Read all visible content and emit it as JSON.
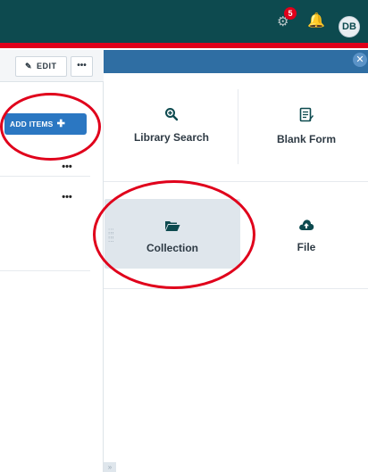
{
  "topbar": {
    "notifications_count": "5",
    "user_initials": "DB",
    "icons": [
      "gear-icon",
      "bell-icon"
    ]
  },
  "toolbar": {
    "edit_label": "EDIT",
    "more_label": "•••"
  },
  "sidebar": {
    "add_items_label": "ADD ITEMS",
    "row_more_label": "•••"
  },
  "tiles": {
    "library_search": "Library Search",
    "blank_form": "Blank Form",
    "collection": "Collection",
    "file": "File"
  },
  "colors": {
    "topbar": "#0d4a4f",
    "accent_red": "#e0001b",
    "modal_bar": "#2f6ea3",
    "primary_button": "#2b77c2",
    "selected_tile": "#dfe6ec"
  }
}
